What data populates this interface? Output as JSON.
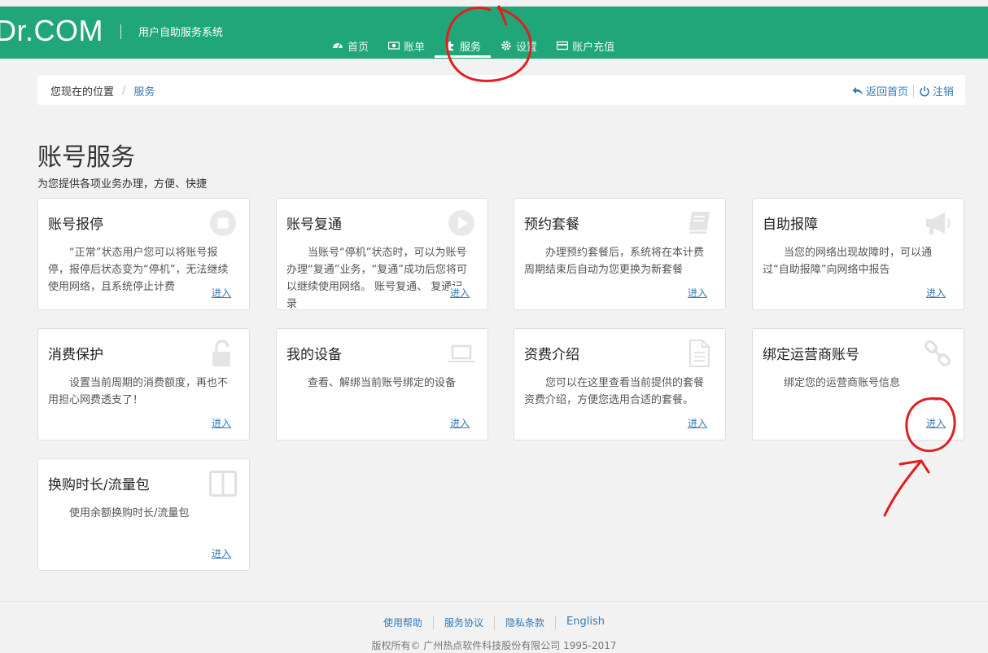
{
  "header": {
    "brand": "Dr.COM",
    "subtitle": "用户自助服务系统",
    "nav": [
      {
        "label": "首页",
        "icon": "dashboard-icon",
        "active": false
      },
      {
        "label": "账单",
        "icon": "money-icon",
        "active": false
      },
      {
        "label": "服务",
        "icon": "puzzle-icon",
        "active": true
      },
      {
        "label": "设置",
        "icon": "gear-icon",
        "active": false
      },
      {
        "label": "账户充值",
        "icon": "credit-card-icon",
        "active": false
      }
    ]
  },
  "breadcrumb": {
    "location_label": "您现在的位置",
    "separator": "/",
    "current": "服务",
    "back_home": "返回首页",
    "logout": "注销"
  },
  "page": {
    "title": "账号服务",
    "subtitle": "为您提供各项业务办理，方便、快捷"
  },
  "cards": [
    {
      "title": "账号报停",
      "desc": "“正常”状态用户您可以将账号报停，报停后状态变为“停机”，无法继续使用网络，且系统停止计费",
      "icon": "stop-icon",
      "link": "进入"
    },
    {
      "title": "账号复通",
      "desc": "当账号“停机”状态时，可以为账号办理“复通”业务，“复通”成功后您将可以继续使用网络。 账号复通、 复通记录",
      "icon": "play-icon",
      "link": "进入"
    },
    {
      "title": "预约套餐",
      "desc": "办理预约套餐后，系统将在本计费周期结束后自动为您更换为新套餐",
      "icon": "book-icon",
      "link": "进入"
    },
    {
      "title": "自助报障",
      "desc": "当您的网络出现故障时，可以通过“自助报障”向网络中报告",
      "icon": "bullhorn-icon",
      "link": "进入"
    },
    {
      "title": "消费保护",
      "desc": "设置当前周期的消费额度，再也不用担心网费透支了！",
      "icon": "unlock-icon",
      "link": "进入"
    },
    {
      "title": "我的设备",
      "desc": "查看、解绑当前账号绑定的设备",
      "icon": "laptop-icon",
      "link": "进入"
    },
    {
      "title": "资费介绍",
      "desc": "您可以在这里查看当前提供的套餐资费介绍，方便您选用合适的套餐。",
      "icon": "document-icon",
      "link": "进入"
    },
    {
      "title": "绑定运营商账号",
      "desc": "绑定您的运营商账号信息",
      "icon": "link-icon",
      "link": "进入"
    },
    {
      "title": "换购时长/流量包",
      "desc": "使用余额换购时长/流量包",
      "icon": "columns-icon",
      "link": "进入"
    }
  ],
  "footer": {
    "links": [
      "使用帮助",
      "服务协议",
      "隐私条款",
      "English"
    ],
    "copyright": "版权所有© 广州热点软件科技股份有限公司 1995-2017"
  },
  "colors": {
    "header_bg": "#21a67a",
    "link": "#337ab7",
    "annotation": "#e01f1f"
  }
}
